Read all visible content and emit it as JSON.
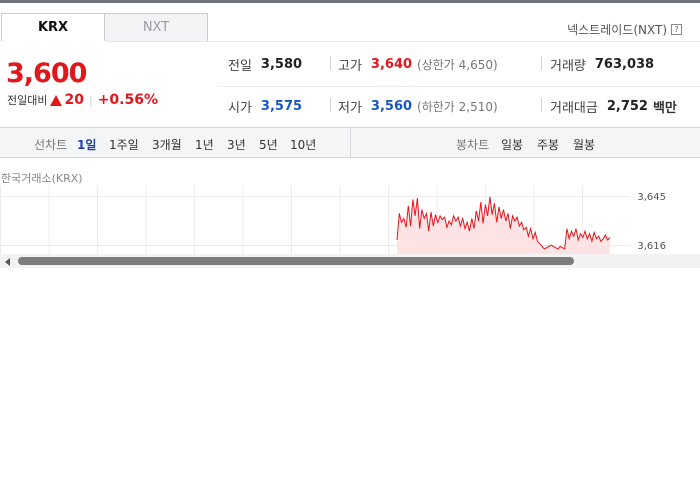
{
  "tabs": [
    {
      "label": "KRX",
      "active": true
    },
    {
      "label": "NXT",
      "active": false
    }
  ],
  "nxt_link": {
    "label": "넥스트레이드(NXT)",
    "help_icon": "question-icon",
    "help_glyph": "?"
  },
  "quote": {
    "price": "3,600",
    "change_label": "전일대비",
    "change_amount": "20",
    "change_direction": "up",
    "change_percent": "+0.56%",
    "up_color": "#e1171c",
    "down_color": "#1b56c4"
  },
  "stats": {
    "prev_close": {
      "label": "전일",
      "value": "3,580"
    },
    "high": {
      "label": "고가",
      "value": "3,640",
      "sub": "(상한가 4,650)"
    },
    "volume": {
      "label": "거래량",
      "value": "763,038"
    },
    "open": {
      "label": "시가",
      "value": "3,575"
    },
    "low": {
      "label": "저가",
      "value": "3,560",
      "sub": "(하한가 2,510)"
    },
    "trade_value": {
      "label": "거래대금",
      "value": "2,752",
      "unit": "백만"
    }
  },
  "line_chart_periods": {
    "label": "선차트",
    "items": [
      "1일",
      "1주일",
      "3개월",
      "1년",
      "3년",
      "5년",
      "10년"
    ],
    "active": "1일"
  },
  "candle_chart_periods": {
    "label": "봉차트",
    "items": [
      "일봉",
      "주봉",
      "월봉"
    ]
  },
  "chart_source": "한국거래소(KRX)",
  "chart_data": {
    "type": "area",
    "y_ticks": [
      "3,645",
      "3,616"
    ],
    "ylim": [
      3600,
      3652
    ],
    "grid": true,
    "color": "#e1171c",
    "fill": "#fde3e4",
    "series": [
      {
        "values": [
          3611,
          3632,
          3625,
          3628,
          3621,
          3638,
          3622,
          3643,
          3630,
          3644,
          3620,
          3635,
          3628,
          3632,
          3618,
          3633,
          3622,
          3631,
          3625,
          3630,
          3627,
          3629,
          3621,
          3626,
          3623,
          3630,
          3626,
          3629,
          3622,
          3628,
          3620,
          3625,
          3618,
          3628,
          3620,
          3634,
          3626,
          3641,
          3624,
          3639,
          3630,
          3645,
          3631,
          3640,
          3625,
          3637,
          3628,
          3635,
          3626,
          3632,
          3620,
          3630,
          3626,
          3629,
          3622,
          3625,
          3619,
          3621,
          3614,
          3620,
          3612,
          3617,
          3610,
          3608,
          3606,
          3604,
          3605,
          3606,
          3607,
          3606,
          3605,
          3604,
          3606,
          3605,
          3604,
          3620,
          3612,
          3618,
          3614,
          3620,
          3611,
          3616,
          3613,
          3618,
          3612,
          3616,
          3610,
          3617,
          3612,
          3614,
          3610,
          3612,
          3615,
          3611,
          3613
        ]
      }
    ]
  }
}
